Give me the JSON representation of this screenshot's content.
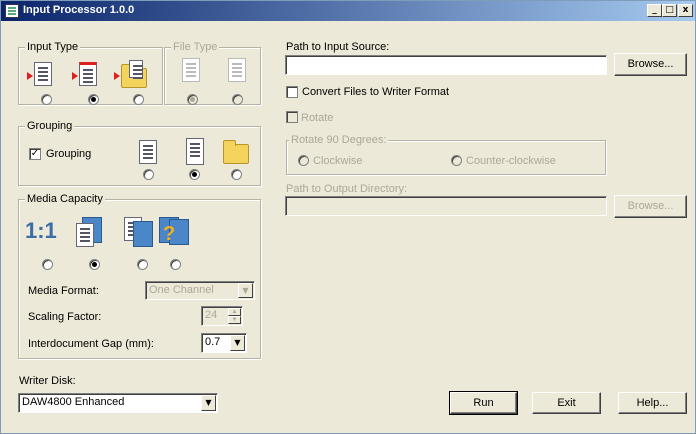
{
  "window": {
    "title": "Input Processor 1.0.0",
    "minimize": "_",
    "maximize": "□",
    "close": "x"
  },
  "input_type": {
    "label": "Input Type",
    "selected_index": 1
  },
  "file_type": {
    "label": "File Type",
    "selected_index": 0
  },
  "grouping": {
    "group_label": "Grouping",
    "checkbox_label": "Grouping",
    "checked": true,
    "check_mark": "✓",
    "selected_index": 1
  },
  "media_capacity": {
    "label": "Media Capacity",
    "one_to_one": "1:1",
    "selected_index": 1
  },
  "media_format": {
    "label": "Media Format:",
    "value": "One Channel"
  },
  "scaling_factor": {
    "label": "Scaling Factor:",
    "value": "24"
  },
  "interdocument_gap": {
    "label": "Interdocument Gap (mm):",
    "value": "0.7"
  },
  "writer_disk": {
    "label": "Writer Disk:",
    "value": "DAW4800 Enhanced"
  },
  "input_source": {
    "label": "Path to Input Source:",
    "value": "",
    "browse_label": "Browse..."
  },
  "convert": {
    "label": "Convert Files to Writer Format",
    "checked": false
  },
  "rotate": {
    "label": "Rotate",
    "checked": false
  },
  "rotate_90": {
    "label": "Rotate 90 Degrees:",
    "clockwise": "Clockwise",
    "counter_clockwise": "Counter-clockwise"
  },
  "output_dir": {
    "label": "Path to Output Directory:",
    "value": "",
    "browse_label": "Browse..."
  },
  "actions": {
    "run": "Run",
    "exit": "Exit",
    "help": "Help..."
  },
  "glyphs": {
    "dropdown_arrow": "▼",
    "spin_up": "▲",
    "spin_down": "▼",
    "question": "?"
  }
}
